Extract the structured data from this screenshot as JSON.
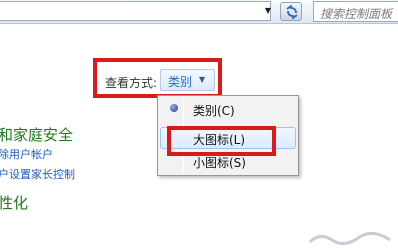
{
  "address_bar": {
    "search_placeholder": "搜索控制面板",
    "dropdown_icon": "chevron-down-icon",
    "refresh_icon": "refresh-icon"
  },
  "view_by": {
    "label": "查看方式:",
    "value": "类别",
    "arrow_icon": "triangle-down-icon"
  },
  "menu": {
    "items": [
      {
        "label": "类别(C)",
        "selected": true
      },
      {
        "label": "大图标(L)",
        "hovered": true
      },
      {
        "label": "小图标(S)"
      }
    ]
  },
  "categories": [
    {
      "title": "和家庭安全",
      "links": [
        "除用户帐户",
        "户设置家长控制"
      ]
    },
    {
      "title": "性化",
      "links": []
    }
  ],
  "colors": {
    "highlight_red": "#dd1a1a",
    "link_blue": "#1f5fbf",
    "category_green": "#1e7a1e"
  }
}
